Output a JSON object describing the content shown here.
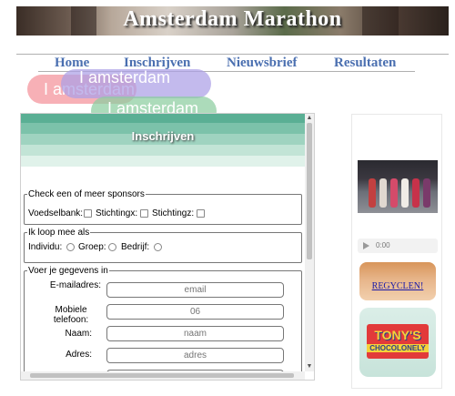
{
  "header": {
    "title": "Amsterdam Marathon"
  },
  "nav": [
    {
      "label": "Home"
    },
    {
      "label": "Inschrijven"
    },
    {
      "label": "Nieuwsbrief"
    },
    {
      "label": "Resultaten"
    }
  ],
  "bubbles": [
    {
      "text": "I amsterdam"
    },
    {
      "text": "I amsterdam"
    },
    {
      "text": "I amsterdam"
    }
  ],
  "form": {
    "title": "Inschrijven",
    "sponsors": {
      "legend": "Check een of meer sponsors",
      "options": [
        "Voedselbank:",
        "Stichtingx:",
        "Stichtingz:"
      ]
    },
    "group": {
      "legend": "Ik loop mee als",
      "options": [
        "Individu:",
        "Groep:",
        "Bedrijf:"
      ]
    },
    "details": {
      "legend": "Voer je gegevens in",
      "fields": [
        {
          "label": "E-mailadres:",
          "placeholder": "email"
        },
        {
          "label": "Mobiele telefoon:",
          "placeholder": "06"
        },
        {
          "label": "Naam:",
          "placeholder": "naam"
        },
        {
          "label": "Adres:",
          "placeholder": "adres"
        }
      ]
    }
  },
  "sidebar": {
    "audio_time": "0:00",
    "ad1_link": "REGYCLEN!",
    "ad2_brand": "TONY'S",
    "ad2_sub": "CHOCOLONELY"
  },
  "colors": {
    "nav": "#4a6fb0",
    "panel_stripe": "#5aaf94"
  }
}
